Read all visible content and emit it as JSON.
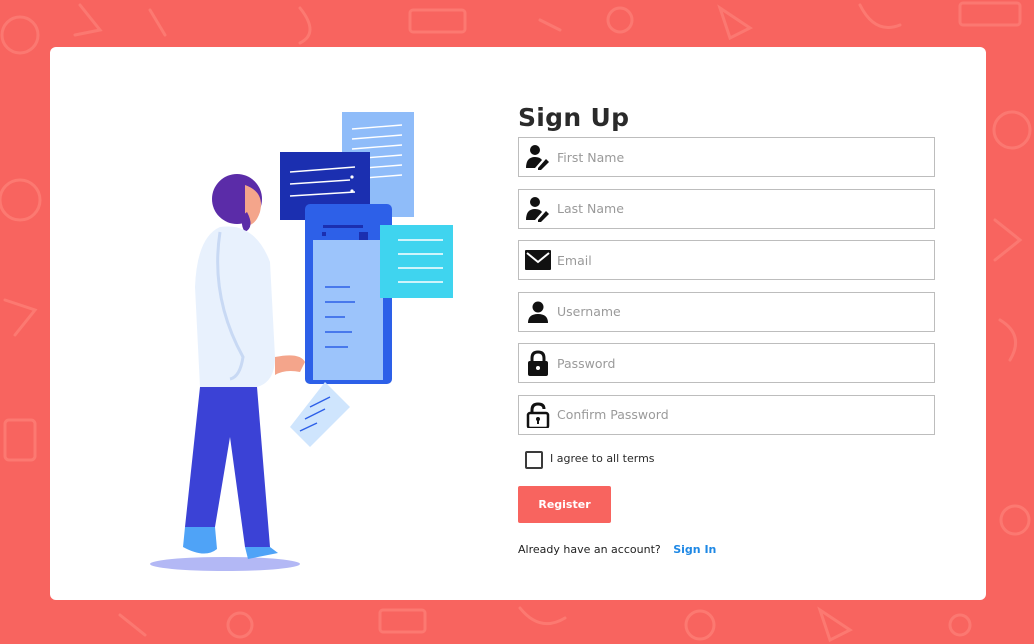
{
  "colors": {
    "accent": "#f8645f",
    "link": "#1e88e5",
    "card": "#ffffff"
  },
  "form": {
    "title": "Sign Up",
    "fields": [
      {
        "icon": "user-edit-icon",
        "placeholder": "First Name"
      },
      {
        "icon": "user-edit-icon",
        "placeholder": "Last Name"
      },
      {
        "icon": "envelope-icon",
        "placeholder": "Email"
      },
      {
        "icon": "user-icon",
        "placeholder": "Username"
      },
      {
        "icon": "lock-icon",
        "placeholder": "Password"
      },
      {
        "icon": "unlock-icon",
        "placeholder": "Confirm Password"
      }
    ],
    "terms_label": "I agree to all terms",
    "terms_checked": false,
    "register_label": "Register",
    "account_prompt": "Already have an account?",
    "signin_label": "Sign In"
  }
}
